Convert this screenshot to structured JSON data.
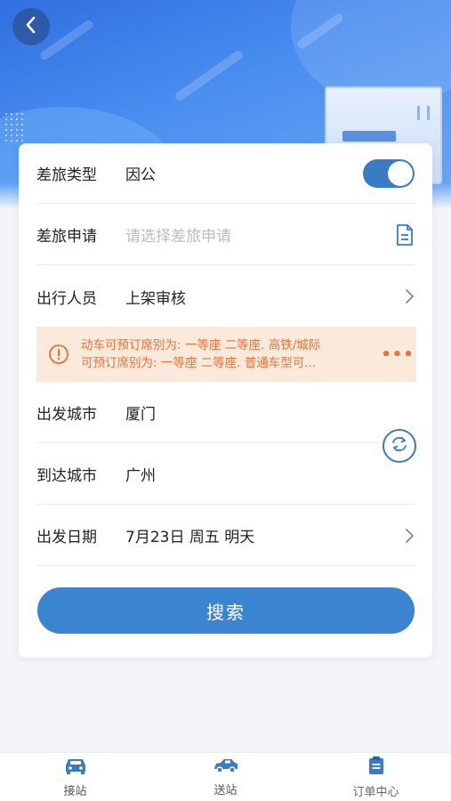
{
  "form": {
    "travel_type": {
      "label": "差旅类型",
      "value": "因公",
      "toggle_on": true
    },
    "travel_request": {
      "label": "差旅申请",
      "placeholder": "请选择差旅申请"
    },
    "traveler": {
      "label": "出行人员",
      "value": "上架审核"
    },
    "notice": {
      "line1": "动车可预订席别为: 一等座 二等座. 高铁/城际",
      "line2": "可预订席别为: 一等座 二等座. 普通车型可...",
      "more": "•••"
    },
    "departure_city": {
      "label": "出发城市",
      "value": "厦门"
    },
    "arrival_city": {
      "label": "到达城市",
      "value": "广州"
    },
    "departure_date": {
      "label": "出发日期",
      "value": "7月23日 周五 明天"
    },
    "search_label": "搜索"
  },
  "tabbar": {
    "items": [
      {
        "label": "接站",
        "icon": "car-front-icon"
      },
      {
        "label": "送站",
        "icon": "car-side-icon"
      },
      {
        "label": "订单中心",
        "icon": "clipboard-icon"
      }
    ]
  },
  "colors": {
    "primary": "#3b84cf",
    "toggle": "#3b7bc4",
    "notice_bg": "#fbeadc",
    "notice_text": "#e5753a",
    "hero": "#2f6fe0"
  }
}
